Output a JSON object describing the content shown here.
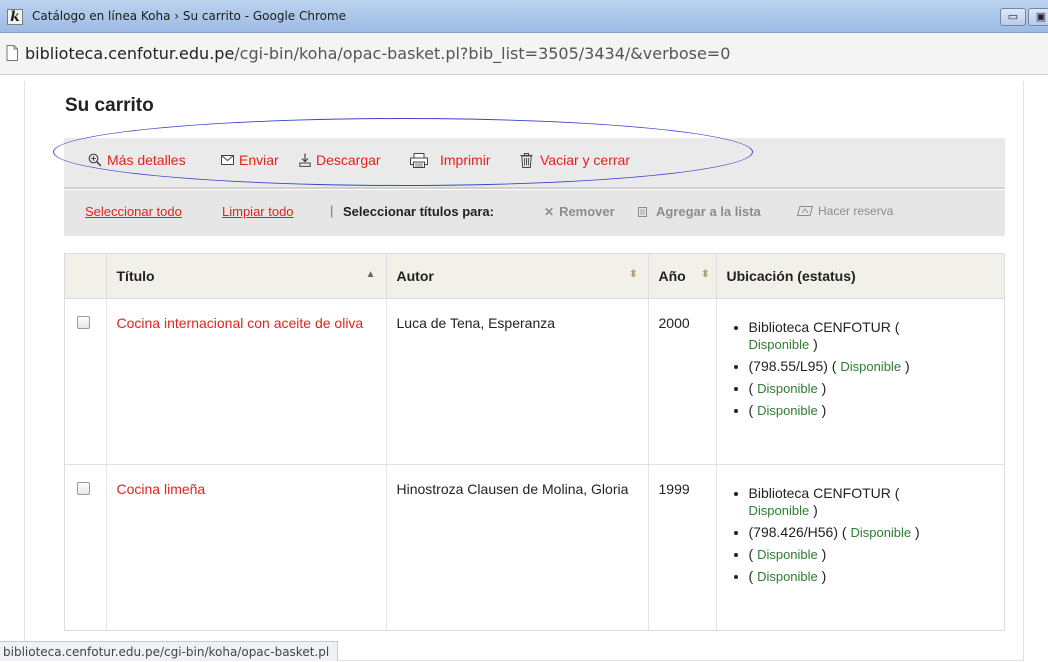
{
  "window": {
    "title": "Catálogo en línea Koha › Su carrito - Google Chrome",
    "app_letter": "k",
    "minimize_glyph": "▭",
    "maximize_glyph": "▣"
  },
  "address": {
    "host": "biblioteca.cenfotur.edu.pe",
    "path": "/cgi-bin/koha/opac-basket.pl?bib_list=3505/3434/&verbose=0"
  },
  "page": {
    "heading": "Su carrito"
  },
  "toolbar": {
    "items": [
      {
        "label": "Más detalles",
        "icon": "zoom-in-icon"
      },
      {
        "label": "Enviar",
        "icon": "envelope-icon"
      },
      {
        "label": "Descargar",
        "icon": "download-icon"
      },
      {
        "label": "Imprimir",
        "icon": "printer-icon"
      },
      {
        "label": "Vaciar y cerrar",
        "icon": "trash-icon"
      }
    ]
  },
  "selection": {
    "select_all": "Seleccionar todo",
    "clear_all": "Limpiar todo",
    "separator": "|",
    "label": "Seleccionar títulos para:",
    "remove": "Remover",
    "add_to_list": "Agregar a la lista",
    "hold": "Hacer reserva"
  },
  "table": {
    "headers": {
      "title": "Título",
      "author": "Autor",
      "year": "Año",
      "location": "Ubicación (estatus)"
    },
    "rows": [
      {
        "title": "Cocina internacional con aceite de oliva",
        "author": "Luca de Tena, Esperanza",
        "year": "2000",
        "items": [
          {
            "location": "Biblioteca CENFOTUR (",
            "status": "Disponible",
            "close": ")"
          },
          {
            "location": "(798.55/L95) (",
            "status": "Disponible",
            "close": ")"
          },
          {
            "location": "(",
            "status": "Disponible",
            "close": ")"
          },
          {
            "location": "(",
            "status": "Disponible",
            "close": ")"
          }
        ]
      },
      {
        "title": "Cocina limeña",
        "author": "Hinostroza Clausen de Molina, Gloria",
        "year": "1999",
        "items": [
          {
            "location": "Biblioteca CENFOTUR (",
            "status": "Disponible",
            "close": ")"
          },
          {
            "location": "(798.426/H56) (",
            "status": "Disponible",
            "close": ")"
          },
          {
            "location": "(",
            "status": "Disponible",
            "close": ")"
          },
          {
            "location": "(",
            "status": "Disponible",
            "close": ")"
          }
        ]
      }
    ]
  },
  "status_bar": {
    "text": "biblioteca.cenfotur.edu.pe/cgi-bin/koha/opac-basket.pl"
  },
  "colors": {
    "link": "#e3221c",
    "available": "#2e7d32",
    "annotation": "#3a45c8"
  }
}
